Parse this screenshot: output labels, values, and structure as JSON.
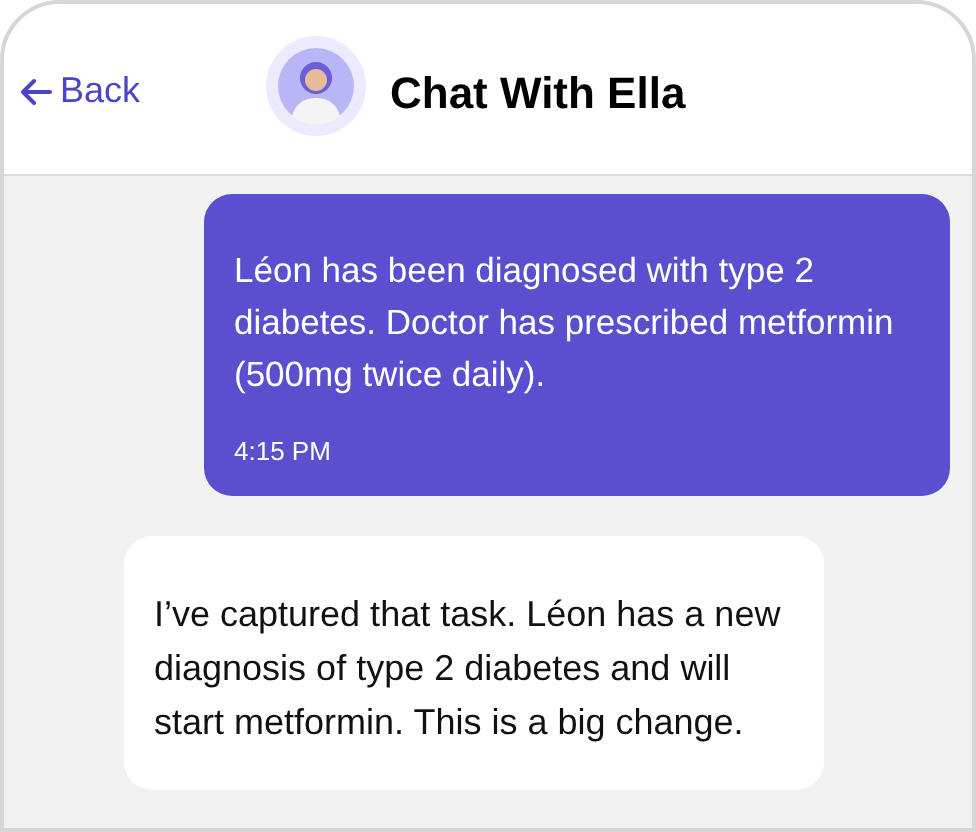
{
  "header": {
    "back_label": "Back",
    "title": "Chat With Ella"
  },
  "messages": [
    {
      "kind": "sent",
      "text": "Léon has been diagnosed with type 2 diabetes. Doctor has prescribed metformin (500mg twice daily).",
      "time": "4:15 PM"
    },
    {
      "kind": "received",
      "text": "I’ve captured that task. Léon has a new diagnosis of type 2 diabetes and will start metformin. This is a big change."
    }
  ]
}
